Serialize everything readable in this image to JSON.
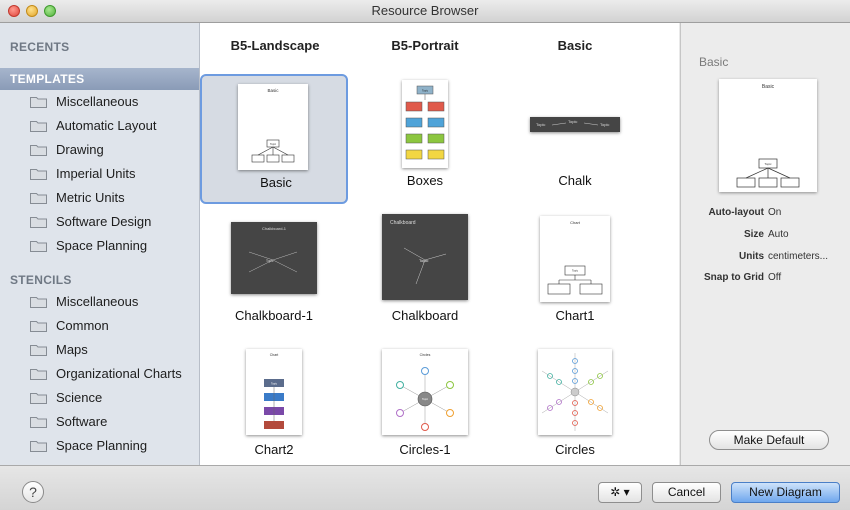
{
  "window": {
    "title": "Resource Browser"
  },
  "sidebar": {
    "recents_label": "RECENTS",
    "templates_label": "TEMPLATES",
    "templates": [
      {
        "label": "Miscellaneous"
      },
      {
        "label": "Automatic Layout"
      },
      {
        "label": "Drawing"
      },
      {
        "label": "Imperial Units"
      },
      {
        "label": "Metric Units"
      },
      {
        "label": "Software Design"
      },
      {
        "label": "Space Planning"
      }
    ],
    "stencils_label": "STENCILS",
    "stencils": [
      {
        "label": "Miscellaneous"
      },
      {
        "label": "Common"
      },
      {
        "label": "Maps"
      },
      {
        "label": "Organizational Charts"
      },
      {
        "label": "Science"
      },
      {
        "label": "Software"
      },
      {
        "label": "Space Planning"
      }
    ]
  },
  "grid": {
    "column_headers": [
      "B5-Landscape",
      "B5-Portrait",
      "Basic"
    ],
    "items": [
      {
        "label": "Basic",
        "thumb_title": "Basic",
        "thumb_text": "Topic"
      },
      {
        "label": "Boxes",
        "thumb_text": "Topic"
      },
      {
        "label": "Chalk",
        "thumb_text": "Topic"
      },
      {
        "label": "Chalkboard-1",
        "thumb_title": "Chalkboard-1",
        "thumb_text": "Topic"
      },
      {
        "label": "Chalkboard",
        "thumb_title": "Chalkboard",
        "thumb_text": "Topic"
      },
      {
        "label": "Chart1",
        "thumb_title": "Chart",
        "thumb_text": "Topic"
      },
      {
        "label": "Chart2",
        "thumb_title": "Chart",
        "thumb_text": "Topic"
      },
      {
        "label": "Circles-1",
        "thumb_title": "Circles",
        "thumb_text": "Topic"
      },
      {
        "label": "Circles"
      }
    ]
  },
  "info": {
    "title": "Basic",
    "thumb_title": "Basic",
    "thumb_text": "Topic",
    "properties": [
      {
        "key": "Auto-layout",
        "value": "On"
      },
      {
        "key": "Size",
        "value": "Auto"
      },
      {
        "key": "Units",
        "value": "centimeters..."
      },
      {
        "key": "Snap to Grid",
        "value": "Off"
      }
    ],
    "make_default_label": "Make Default"
  },
  "footer": {
    "help_label": "?",
    "gear_menu_glyph": "✲ ▾",
    "cancel_label": "Cancel",
    "new_diagram_label": "New Diagram"
  },
  "colors": {
    "selection_border": "#6d9be0",
    "primary_button": "#6fa7ee",
    "sidebar_selected": "#8a9bb7"
  },
  "icons": [
    "folder-icon",
    "gear-icon",
    "help-icon"
  ]
}
